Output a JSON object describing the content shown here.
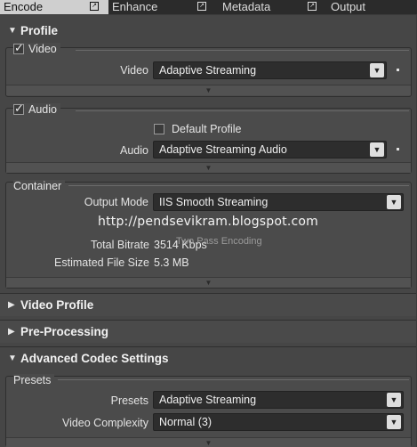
{
  "tabs": [
    {
      "label": "Encode",
      "active": true
    },
    {
      "label": "Enhance",
      "active": false
    },
    {
      "label": "Metadata",
      "active": false
    },
    {
      "label": "Output",
      "active": false
    }
  ],
  "profile": {
    "title": "Profile",
    "video_group": {
      "label": "Video",
      "checked": true,
      "field_label": "Video",
      "value": "Adaptive Streaming"
    },
    "audio_group": {
      "label": "Audio",
      "checked": true,
      "default_profile_label": "Default Profile",
      "default_profile_checked": false,
      "field_label": "Audio",
      "value": "Adaptive Streaming Audio"
    },
    "container_group": {
      "label": "Container",
      "output_mode_label": "Output Mode",
      "output_mode_value": "IIS Smooth Streaming",
      "two_pass_label": "Two Pass Encoding",
      "total_bitrate_label": "Total Bitrate",
      "total_bitrate_value": "3514 Kbps",
      "file_size_label": "Estimated File Size",
      "file_size_value": "5.3 MB"
    }
  },
  "watermark": "http://pendsevikram.blogspot.com",
  "sections": {
    "video_profile": "Video Profile",
    "pre_processing": "Pre-Processing",
    "advanced_codec": "Advanced Codec Settings"
  },
  "presets_group": {
    "label": "Presets",
    "presets_label": "Presets",
    "presets_value": "Adaptive Streaming",
    "complexity_label": "Video Complexity",
    "complexity_value": "Normal (3)"
  },
  "icons": {
    "expand": "triangle-down-icon",
    "collapse": "triangle-right-icon",
    "popout": "popout-icon",
    "dropdown": "chevron-down-icon"
  }
}
